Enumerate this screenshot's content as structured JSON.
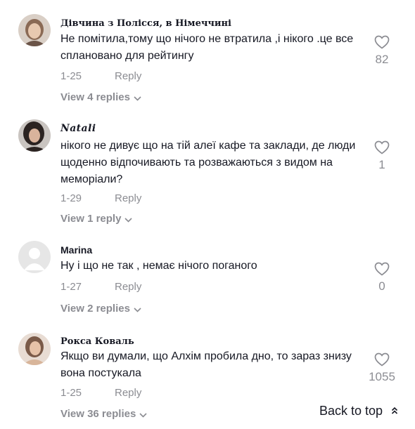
{
  "comments": [
    {
      "author": "Дівчина з Полісся, в Німеччині",
      "text": "Не помітила,тому що нічого не втратила ,і нікого .це все сплановано для рейтингу",
      "date": "1-25",
      "reply_label": "Reply",
      "view_replies": "View 4 replies",
      "likes": "82"
    },
    {
      "author": "Natali",
      "text": "нікого не дивує що на тій алеї кафе та заклади, де люди щоденно відпочивають та розважаються з видом на меморіали?",
      "date": "1-29",
      "reply_label": "Reply",
      "view_replies": "View 1 reply",
      "likes": "1"
    },
    {
      "author": "Marina",
      "text": "Ну і що не так , немає нічого поганого",
      "date": "1-27",
      "reply_label": "Reply",
      "view_replies": "View 2 replies",
      "likes": "0"
    },
    {
      "author": "Рокса Коваль",
      "text": "Якщо ви думали, що Алхім пробила дно, то зараз знизу вона постукала",
      "date": "1-25",
      "reply_label": "Reply",
      "view_replies": "View 36 replies",
      "likes": "1055"
    }
  ],
  "back_to_top": "Back to top",
  "icons": {
    "like": "heart-outline-icon",
    "expand": "chevron-down-icon",
    "back_to_top": "double-chevron-up-icon"
  },
  "colors": {
    "text": "#161823",
    "muted": "rgba(22,24,35,0.5)"
  }
}
